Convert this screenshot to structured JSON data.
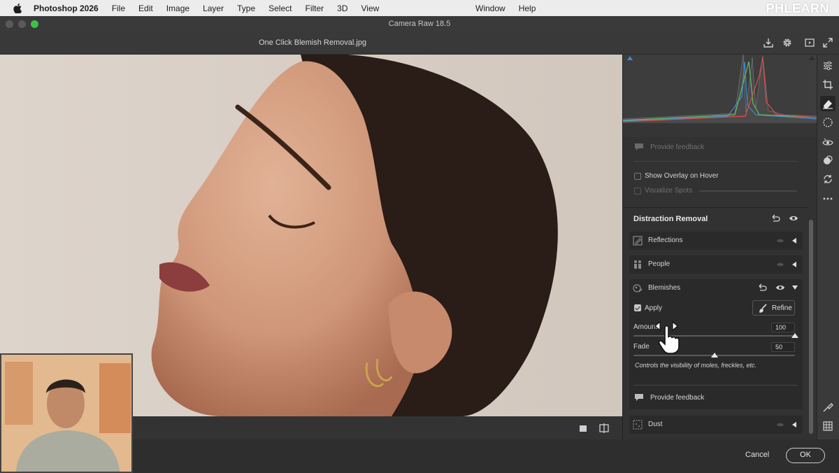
{
  "menubar": {
    "app_name": "Photoshop 2026",
    "items": [
      "File",
      "Edit",
      "Image",
      "Layer",
      "Type",
      "Select",
      "Filter",
      "3D",
      "View"
    ],
    "right_items": [
      "Window",
      "Help"
    ],
    "watermark": "PHLEARN"
  },
  "window": {
    "title": "Camera Raw 18.5"
  },
  "header": {
    "filename": "One Click Blemish Removal.jpg"
  },
  "panel": {
    "top_feedback": "Provide feedback",
    "show_overlay": "Show Overlay on Hover",
    "visualize_spots": "Visualize Spots",
    "section_title": "Distraction Removal",
    "rows": {
      "reflections": "Reflections",
      "people": "People",
      "blemishes": "Blemishes",
      "dust": "Dust"
    },
    "apply_label": "Apply",
    "refine_label": "Refine",
    "amount_label": "Amount",
    "amount_value": "100",
    "amount_level": 100,
    "fade_label": "Fade",
    "fade_value": "50",
    "fade_level": 50,
    "hint": "Controls the visibility of moles, freckles, etc.",
    "feedback": "Provide feedback"
  },
  "footer": {
    "cancel": "Cancel",
    "ok": "OK"
  },
  "colors": {
    "accent": "#3bc14a",
    "panel": "#323232",
    "canvas_bg": "#d8cec5"
  }
}
